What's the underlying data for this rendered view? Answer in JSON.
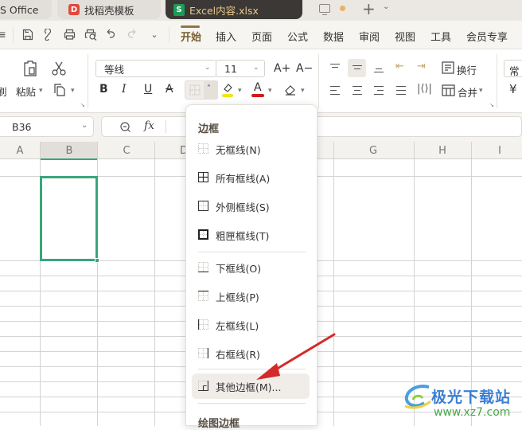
{
  "tabs": [
    {
      "label": "S Office",
      "icon": "wps-logo"
    },
    {
      "label": "找稻壳模板",
      "icon": "docer-icon",
      "icon_letter": "D"
    },
    {
      "label": "Excel内容.xlsx",
      "icon": "spreadsheet-icon",
      "icon_letter": "S",
      "active": true
    }
  ],
  "quick_access": [
    "menu-icon",
    "save-icon",
    "link-icon",
    "print-icon",
    "print-preview-icon",
    "undo-icon",
    "redo-icon",
    "more-chevron-icon"
  ],
  "menu": [
    "开始",
    "插入",
    "页面",
    "公式",
    "数据",
    "审阅",
    "视图",
    "工具",
    "会员专享"
  ],
  "active_menu": "开始",
  "ribbon": {
    "copy_label_partial": "刷",
    "paste_label": "粘贴",
    "font_name": "等线",
    "font_size": "11",
    "grow_font": "A+",
    "shrink_font": "A−",
    "bold": "B",
    "italic": "I",
    "underline": "U",
    "strike": "A",
    "wrap_label": "换行",
    "merge_label": "合并",
    "number_format_partial": "常",
    "currency_partial": "¥"
  },
  "name_box": "B36",
  "fx_label": "fx",
  "columns": [
    "A",
    "B",
    "C",
    "D",
    "G",
    "H",
    "I"
  ],
  "selected_column": "B",
  "border_menu": {
    "title": "边框",
    "items": [
      {
        "label": "无框线(N)",
        "icon": "no-border-icon"
      },
      {
        "label": "所有框线(A)",
        "icon": "all-borders-icon"
      },
      {
        "label": "外侧框线(S)",
        "icon": "outside-borders-icon"
      },
      {
        "label": "粗匣框线(T)",
        "icon": "thick-box-border-icon"
      },
      {
        "label": "下框线(O)",
        "icon": "bottom-border-icon"
      },
      {
        "label": "上框线(P)",
        "icon": "top-border-icon"
      },
      {
        "label": "左框线(L)",
        "icon": "left-border-icon"
      },
      {
        "label": "右框线(R)",
        "icon": "right-border-icon"
      },
      {
        "label": "其他边框(M)...",
        "icon": "more-borders-icon",
        "highlighted": true
      }
    ],
    "draw_title": "绘图边框"
  },
  "watermark": {
    "name": "极光下载站",
    "url": "www.xz7.com"
  },
  "colors": {
    "accent": "#3aa67b",
    "menu_active": "#8f7547",
    "arrow": "#d42a2a",
    "tab_active_bg": "#3b3835"
  }
}
